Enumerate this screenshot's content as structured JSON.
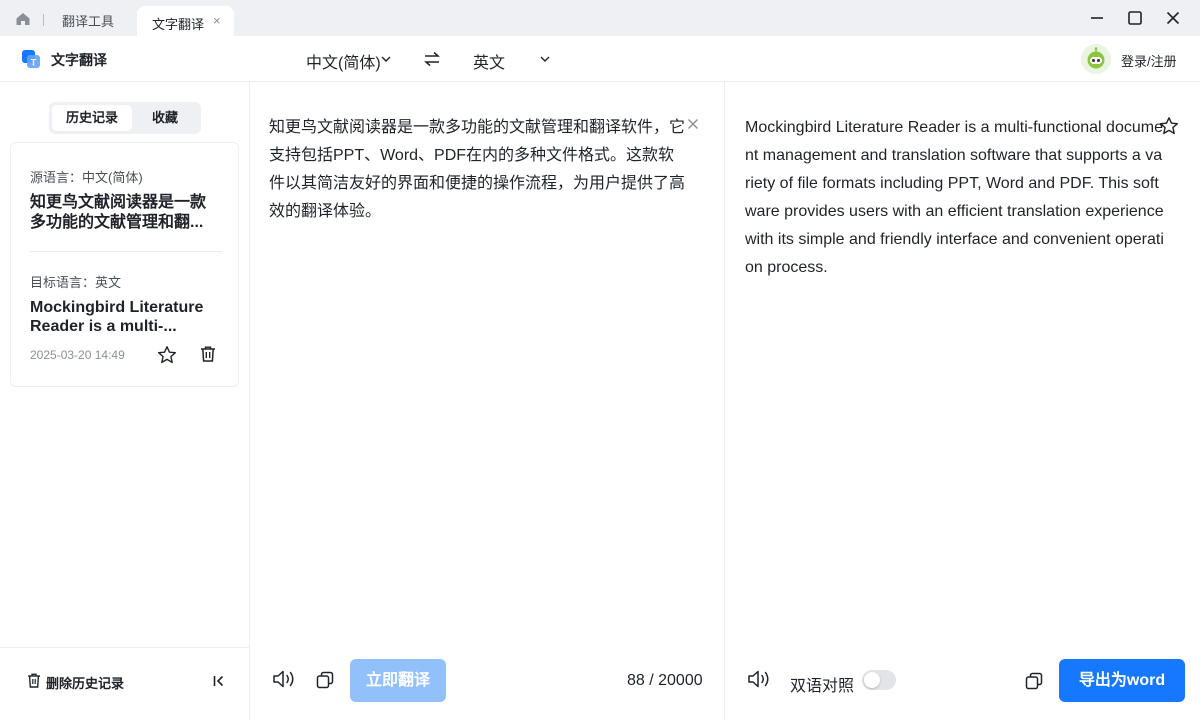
{
  "tabs": {
    "home_icon": "home-icon",
    "tool_tab": "翻译工具",
    "active_tab": "文字翻译",
    "close_glyph": "×"
  },
  "header": {
    "app_title": "文字翻译",
    "source_language": "中文(简体)",
    "target_language": "英文",
    "login_label": "登录/注册"
  },
  "sidebar": {
    "segments": [
      "历史记录",
      "收藏"
    ],
    "active_segment": "历史记录",
    "history": [
      {
        "source_label": "源语言：中文(简体)",
        "source_text": "知更鸟文献阅读器是一款多功能的文献管理和翻...",
        "target_label": "目标语言：英文",
        "target_text": "Mockingbird Literature Reader is a multi-...",
        "time": "2025-03-20 14:49"
      }
    ],
    "delete_history_label": "删除历史记录"
  },
  "source_pane": {
    "text": "知更鸟文献阅读器是一款多功能的文献管理和翻译软件，它支持包括PPT、Word、PDF在内的多种文件格式。这款软件以其简洁友好的界面和便捷的操作流程，为用户提供了高效的翻译体验。",
    "translate_button": "立即翻译",
    "char_count": "88 / 20000"
  },
  "target_pane": {
    "text": "Mockingbird Literature Reader is a multi-functional document management and translation software that supports a variety of file formats including PPT, Word and PDF. This software provides users with an efficient translation experience with its simple and friendly interface and convenient operation process.",
    "bilingual_label": "双语对照",
    "bilingual_enabled": false,
    "export_button": "导出为word"
  },
  "colors": {
    "accent": "#1677ff",
    "accent_disabled": "#92c0fb",
    "titlebar_bg": "#eef0f4",
    "divider": "#ebedf0"
  }
}
